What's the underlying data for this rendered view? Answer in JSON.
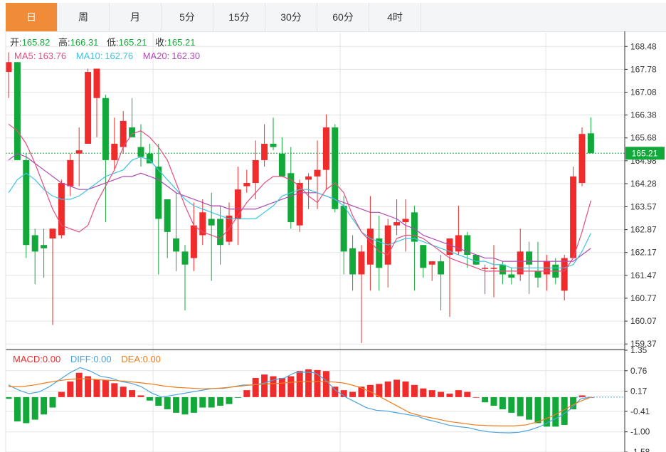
{
  "tabs": [
    {
      "label": "日",
      "active": true
    },
    {
      "label": "周",
      "active": false
    },
    {
      "label": "月",
      "active": false
    },
    {
      "label": "5分",
      "active": false
    },
    {
      "label": "15分",
      "active": false
    },
    {
      "label": "30分",
      "active": false
    },
    {
      "label": "60分",
      "active": false
    },
    {
      "label": "4时",
      "active": false
    }
  ],
  "ohlc_info": {
    "open_label": "开:",
    "open": "165.82",
    "high_label": "高:",
    "high": "166.31",
    "low_label": "低:",
    "low": "165.21",
    "close_label": "收:",
    "close": "165.21"
  },
  "ma_info": {
    "ma5_label": "MA5:",
    "ma5": "163.76",
    "ma10_label": "MA10:",
    "ma10": "162.76",
    "ma20_label": "MA20:",
    "ma20": "162.30"
  },
  "macd_info": {
    "macd_label": "MACD:",
    "macd": "0.00",
    "diff_label": "DIFF:",
    "diff": "0.00",
    "dea_label": "DEA:",
    "dea": "0.00"
  },
  "last_price": "165.21",
  "colors": {
    "up": "#ef2b2b",
    "down": "#12a83a",
    "ma5": "#e44d7c",
    "ma10": "#3ec3e0",
    "ma20": "#b04ab3",
    "diff": "#4aa3e0",
    "dea": "#f07d1e",
    "grid": "#e3e3e3",
    "tab_active": "#f08c38"
  },
  "chart_data": [
    {
      "type": "candlestick",
      "y_ticks": [
        "168.48",
        "167.78",
        "167.08",
        "166.38",
        "165.68",
        "164.98",
        "164.28",
        "163.57",
        "162.87",
        "162.17",
        "161.47",
        "160.77",
        "160.07",
        "159.37"
      ],
      "ylim": [
        159.2,
        168.9
      ],
      "grid": true,
      "last_price_line": 165.21,
      "candles": [
        [
          167.7,
          168.3,
          166.9,
          168.0
        ],
        [
          168.0,
          168.0,
          166.5,
          165.0
        ],
        [
          165.0,
          165.2,
          162.0,
          162.4
        ],
        [
          162.7,
          162.9,
          161.2,
          162.2
        ],
        [
          162.4,
          162.9,
          161.4,
          162.3
        ],
        [
          162.6,
          162.9,
          159.95,
          162.9
        ],
        [
          162.7,
          164.4,
          162.6,
          164.3
        ],
        [
          164.2,
          165.2,
          163.9,
          165.0
        ],
        [
          165.2,
          166.0,
          164.2,
          165.3
        ],
        [
          165.5,
          167.8,
          165.5,
          167.7
        ],
        [
          166.9,
          167.8,
          165.7,
          167.8
        ],
        [
          166.9,
          167.0,
          163.1,
          165.0
        ],
        [
          165.0,
          166.3,
          164.7,
          165.5
        ],
        [
          165.4,
          166.5,
          165.2,
          166.2
        ],
        [
          166.0,
          166.9,
          165.7,
          165.7
        ],
        [
          165.4,
          166.1,
          164.8,
          165.1
        ],
        [
          165.2,
          165.5,
          164.9,
          164.9
        ],
        [
          164.8,
          165.5,
          161.5,
          163.2
        ],
        [
          163.8,
          163.8,
          162.0,
          162.8
        ],
        [
          162.6,
          164.0,
          161.6,
          162.2
        ],
        [
          162.2,
          162.4,
          160.4,
          161.8
        ],
        [
          162.0,
          163.7,
          161.6,
          163.0
        ],
        [
          162.7,
          163.8,
          162.4,
          163.4
        ],
        [
          163.2,
          164.0,
          161.3,
          163.0
        ],
        [
          163.2,
          163.6,
          161.8,
          162.4
        ],
        [
          162.5,
          163.7,
          162.4,
          163.3
        ],
        [
          163.2,
          164.8,
          162.4,
          164.1
        ],
        [
          164.2,
          164.7,
          164.0,
          164.3
        ],
        [
          164.3,
          165.6,
          163.8,
          165.0
        ],
        [
          165.0,
          166.1,
          164.8,
          165.5
        ],
        [
          165.5,
          166.3,
          165.3,
          165.4
        ],
        [
          165.2,
          165.7,
          164.7,
          164.5
        ],
        [
          164.6,
          165.4,
          162.9,
          163.1
        ],
        [
          163.0,
          164.4,
          162.8,
          164.3
        ],
        [
          164.4,
          164.6,
          163.5,
          164.5
        ],
        [
          164.5,
          165.6,
          163.5,
          164.7
        ],
        [
          164.7,
          166.4,
          164.1,
          166.0
        ],
        [
          166.0,
          166.1,
          163.4,
          163.5
        ],
        [
          163.6,
          163.9,
          161.5,
          162.2
        ],
        [
          162.3,
          162.7,
          161.0,
          161.5
        ],
        [
          161.5,
          162.4,
          159.4,
          162.2
        ],
        [
          161.8,
          163.9,
          161.0,
          162.9
        ],
        [
          162.6,
          163.3,
          161.0,
          161.7
        ],
        [
          161.8,
          163.2,
          161.1,
          163.0
        ],
        [
          163.0,
          163.8,
          162.7,
          163.1
        ],
        [
          163.1,
          163.8,
          162.2,
          163.2
        ],
        [
          163.4,
          163.6,
          161.0,
          162.5
        ],
        [
          162.4,
          162.4,
          161.4,
          161.7
        ],
        [
          161.8,
          161.9,
          161.3,
          161.9
        ],
        [
          161.9,
          162.1,
          160.4,
          161.5
        ],
        [
          162.1,
          162.1,
          160.2,
          162.6
        ],
        [
          162.2,
          163.6,
          162.1,
          162.7
        ],
        [
          162.7,
          162.8,
          161.7,
          162.1
        ],
        [
          162.1,
          162.1,
          161.8,
          161.8
        ],
        [
          161.7,
          161.8,
          160.9,
          161.7
        ],
        [
          161.7,
          162.4,
          160.8,
          161.7
        ],
        [
          161.8,
          161.9,
          161.2,
          161.5
        ],
        [
          161.5,
          161.7,
          161.2,
          161.4
        ],
        [
          161.5,
          162.9,
          161.3,
          162.2
        ],
        [
          162.2,
          162.5,
          160.9,
          161.8
        ],
        [
          161.6,
          162.5,
          161.1,
          161.4
        ],
        [
          161.5,
          162.1,
          161.0,
          161.9
        ],
        [
          161.8,
          162.0,
          161.2,
          161.4
        ],
        [
          161.0,
          162.1,
          160.7,
          162.0
        ],
        [
          162.0,
          164.8,
          162.0,
          164.5
        ],
        [
          164.3,
          166.0,
          164.2,
          165.8
        ],
        [
          165.82,
          166.31,
          165.21,
          165.21
        ]
      ],
      "ma5": [
        166.1,
        165.9,
        165.5,
        164.9,
        164.2,
        163.5,
        163.0,
        162.9,
        162.8,
        163.0,
        163.7,
        164.2,
        164.7,
        165.4,
        165.8,
        165.9,
        165.7,
        165.4,
        165.0,
        164.3,
        163.6,
        163.0,
        162.8,
        162.7,
        162.6,
        162.9,
        163.3,
        163.7,
        164.0,
        164.3,
        164.5,
        164.5,
        164.4,
        164.2,
        163.9,
        163.7,
        164.1,
        164.3,
        164.0,
        163.3,
        162.8,
        162.5,
        162.2,
        162.1,
        162.6,
        162.7,
        162.7,
        162.6,
        162.4,
        162.2,
        162.0,
        161.9,
        161.8,
        161.7,
        161.6,
        161.6,
        161.6,
        161.6,
        161.6,
        161.6,
        161.6,
        161.6,
        161.6,
        161.6,
        162.0,
        162.8,
        163.76
      ],
      "ma10": [
        164.0,
        164.4,
        164.6,
        164.4,
        164.1,
        163.9,
        163.8,
        163.8,
        163.9,
        164.1,
        164.3,
        164.5,
        164.6,
        164.7,
        165.0,
        165.1,
        165.0,
        164.7,
        164.4,
        164.1,
        163.8,
        163.6,
        163.5,
        163.4,
        163.3,
        163.2,
        163.2,
        163.2,
        163.2,
        163.4,
        163.6,
        163.9,
        164.0,
        164.1,
        164.1,
        164.0,
        163.9,
        163.8,
        163.6,
        163.2,
        162.8,
        162.6,
        162.5,
        162.4,
        162.5,
        162.6,
        162.6,
        162.5,
        162.4,
        162.3,
        162.2,
        162.1,
        162.0,
        161.9,
        161.9,
        161.8,
        161.8,
        161.7,
        161.7,
        161.7,
        161.7,
        161.7,
        161.7,
        161.7,
        161.8,
        162.2,
        162.76
      ],
      "ma20": [
        165.0,
        165.2,
        165.1,
        164.9,
        164.7,
        164.5,
        164.3,
        164.2,
        164.1,
        164.1,
        164.2,
        164.3,
        164.4,
        164.5,
        164.5,
        164.6,
        164.5,
        164.4,
        164.2,
        164.0,
        163.9,
        163.8,
        163.7,
        163.6,
        163.6,
        163.5,
        163.5,
        163.5,
        163.5,
        163.6,
        163.7,
        163.8,
        163.9,
        164.0,
        164.0,
        164.0,
        163.9,
        163.8,
        163.7,
        163.6,
        163.5,
        163.4,
        163.4,
        163.3,
        163.2,
        163.0,
        162.9,
        162.7,
        162.6,
        162.5,
        162.4,
        162.3,
        162.2,
        162.1,
        162.0,
        162.0,
        161.9,
        161.9,
        161.9,
        161.9,
        161.9,
        161.9,
        161.9,
        161.9,
        161.9,
        162.1,
        162.3
      ]
    },
    {
      "type": "macd",
      "y_ticks": [
        "1.35",
        "0.76",
        "0.17",
        "-0.41",
        "-1.00",
        "-1.58"
      ],
      "ylim": [
        -1.58,
        1.35
      ],
      "hist": [
        -0.05,
        -0.7,
        -0.75,
        -0.65,
        -0.5,
        -0.3,
        0.15,
        0.45,
        0.7,
        0.6,
        0.5,
        0.5,
        0.4,
        0.3,
        0.2,
        0.05,
        -0.1,
        -0.25,
        -0.35,
        -0.45,
        -0.5,
        -0.45,
        -0.3,
        -0.3,
        -0.25,
        -0.2,
        -0.02,
        0.2,
        0.55,
        0.65,
        0.6,
        0.55,
        0.6,
        0.75,
        0.8,
        0.78,
        0.75,
        0.3,
        0.2,
        0.15,
        0.3,
        0.35,
        0.38,
        0.45,
        0.5,
        0.45,
        0.35,
        0.25,
        0.2,
        0.15,
        0.1,
        0.2,
        0.15,
        0.0,
        -0.15,
        -0.25,
        -0.35,
        -0.45,
        -0.55,
        -0.65,
        -0.75,
        -0.85,
        -0.85,
        -0.8,
        -0.35,
        0.05,
        0.0
      ],
      "diff": [
        0.35,
        0.2,
        0.1,
        0.15,
        0.3,
        0.5,
        0.7,
        0.85,
        0.75,
        0.6,
        0.55,
        0.45,
        0.4,
        0.3,
        0.12,
        0.0,
        0.05,
        0.1,
        0.15,
        0.2,
        0.25,
        0.25,
        0.3,
        0.35,
        0.35,
        0.4,
        0.5,
        0.55,
        0.7,
        0.72,
        0.7,
        0.5,
        0.2,
        0.0,
        -0.15,
        -0.3,
        -0.38,
        -0.4,
        -0.45,
        -0.5,
        -0.55,
        -0.65,
        -0.72,
        -0.8,
        -0.85,
        -0.88,
        -0.95,
        -1.0,
        -1.02,
        -1.03,
        -1.01,
        -0.95,
        -0.85,
        -0.7,
        -0.55,
        -0.35,
        -0.05,
        0.0
      ],
      "dea": [
        0.3,
        0.3,
        0.35,
        0.42,
        0.48,
        0.52,
        0.53,
        0.5,
        0.48,
        0.46,
        0.42,
        0.38,
        0.32,
        0.28,
        0.26,
        0.24,
        0.25,
        0.28,
        0.32,
        0.36,
        0.38,
        0.4,
        0.43,
        0.45,
        0.45,
        0.44,
        0.4,
        0.3,
        0.15,
        -0.05,
        -0.25,
        -0.45,
        -0.55,
        -0.62,
        -0.7,
        -0.75,
        -0.8,
        -0.82,
        -0.83,
        -0.83,
        -0.8,
        -0.7,
        -0.55,
        -0.35,
        -0.15,
        0.0
      ]
    }
  ]
}
